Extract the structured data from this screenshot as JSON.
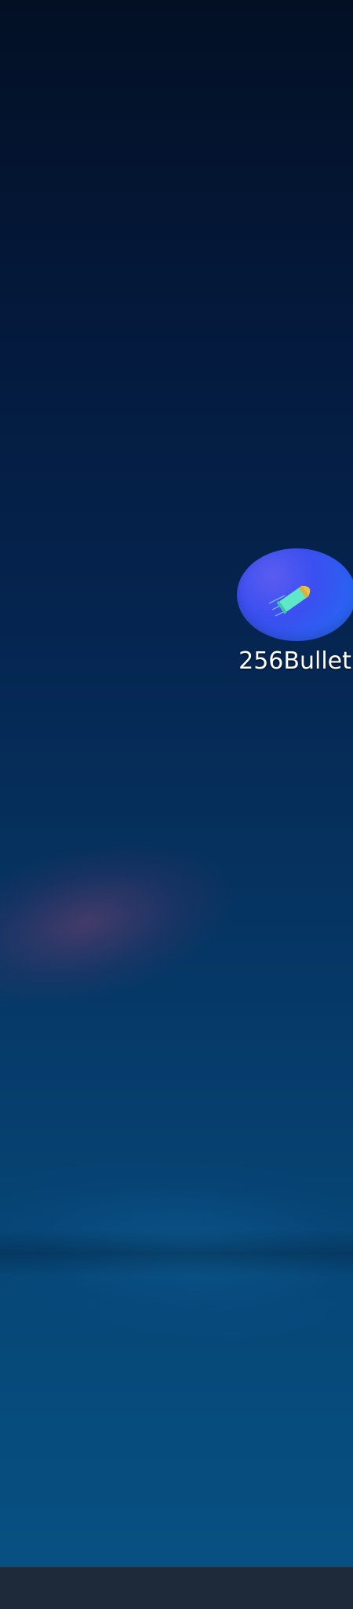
{
  "desktop": {
    "icons": [
      {
        "label": "256Bullet",
        "icon": "bullet-app-icon"
      }
    ]
  },
  "colors": {
    "icon_circle": "#3b4ff0",
    "bullet_body": "#5ee8c8",
    "bullet_tip": "#e8c24a",
    "taskbar": "#1e2a3a"
  }
}
